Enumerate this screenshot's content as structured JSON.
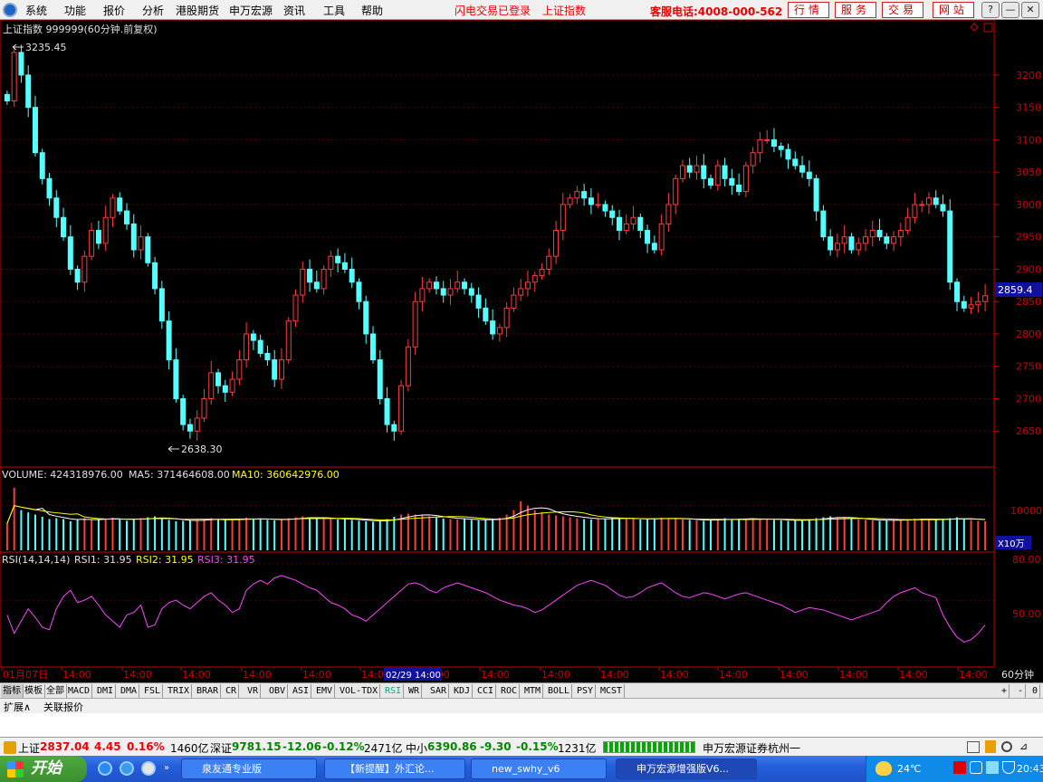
{
  "menubar": {
    "items": [
      "系统",
      "功能",
      "报价",
      "分析",
      "港股期货",
      "申万宏源",
      "资讯",
      "工具",
      "帮助"
    ],
    "status_login": "闪电交易已登录",
    "status_index": "上证指数",
    "hotline": "客服电话:4008-000-562",
    "nav_buttons": [
      "行情",
      "服务",
      "交易",
      "网站"
    ],
    "window_controls": [
      "?",
      "—",
      "❐",
      "✕"
    ]
  },
  "chart_header": {
    "title": "上证指数 999999(60分钟.前复权)",
    "max_label": "3235.45",
    "min_label": "2638.30",
    "last_price": "2859.4"
  },
  "volume_header": {
    "label": "VOLUME: 424318976.00",
    "ma5": "MA5: 371464608.00",
    "ma10": "MA10: 360642976.00",
    "unit": "X10万",
    "tick": "10000"
  },
  "rsi_header": {
    "label": "RSI(14,14,14)",
    "rsi1": "RSI1: 31.95",
    "rsi2": "RSI2: 31.95",
    "rsi3": "RSI3: 31.95"
  },
  "time_axis": {
    "labels": [
      "01月07日",
      "14:00",
      "14:00",
      "14:00",
      "14:00",
      "14:00",
      "14:00",
      "14:00",
      "14:00",
      "14:00",
      "14:00",
      "14:00",
      "14:00",
      "14:00",
      "14:00",
      "14:00",
      "14:00"
    ],
    "cursor_label": "02/29 14:00",
    "period": "60分钟"
  },
  "indicator_tabs": [
    "指标",
    "模板",
    "全部",
    "MACD",
    "DMI",
    "DMA",
    "FSL",
    "TRIX",
    "BRAR",
    "CR",
    "VR",
    "OBV",
    "ASI",
    "EMV",
    "VOL-TDX",
    "RSI",
    "WR",
    "SAR",
    "KDJ",
    "CCI",
    "ROC",
    "MTM",
    "BOLL",
    "PSY",
    "MCST"
  ],
  "active_tab": "RSI",
  "ext_bar": [
    "扩展∧",
    "关联报价"
  ],
  "index_bar": {
    "sh_name": "上证",
    "sh_value": "2837.04",
    "sh_change": "4.45",
    "sh_pct": "0.16%",
    "sh_amount": "1460亿",
    "sz_name": "深证",
    "sz_value": "9781.15",
    "sz_change": "-12.06",
    "sz_pct": "-0.12%",
    "sz_amount": "2471亿",
    "zx_name": "中小",
    "zx_value": "6390.86",
    "zx_change": "-9.30",
    "zx_pct": "-0.15%",
    "zx_amount": "1231亿",
    "broker": "申万宏源证券杭州一"
  },
  "taskbar": {
    "start": "开始",
    "buttons": [
      "泉友通专业版",
      "【新提醒】外汇论...",
      "new_swhy_v6",
      "申万宏源增强版V6..."
    ],
    "temperature": "24℃",
    "time": "20:43"
  },
  "colors": {
    "up": "#ff3c3c",
    "down": "#54ffff",
    "ma5": "#ffffff",
    "ma10": "#ffff00",
    "rsi": "#ff44ff",
    "axis": "#c80000"
  },
  "chart_data": [
    {
      "type": "candlestick",
      "title": "上证指数 999999(60分钟.前复权)",
      "ylim": [
        2600,
        3260
      ],
      "yticks": [
        2650,
        2700,
        2750,
        2800,
        2850,
        2900,
        2950,
        3000,
        3050,
        3100,
        3150,
        3200
      ],
      "x_tick_labels": [
        "01月07日",
        "14:00",
        "14:00",
        "14:00",
        "14:00",
        "14:00",
        "14:00",
        "14:00",
        "14:00",
        "14:00",
        "14:00",
        "14:00",
        "14:00",
        "14:00",
        "14:00",
        "14:00",
        "14:00"
      ],
      "close": [
        3160,
        3235,
        3200,
        3150,
        3080,
        3040,
        3010,
        2980,
        2950,
        2900,
        2880,
        2920,
        2960,
        2940,
        2980,
        3010,
        2990,
        2970,
        2930,
        2950,
        2910,
        2870,
        2820,
        2760,
        2700,
        2660,
        2650,
        2670,
        2700,
        2740,
        2720,
        2710,
        2730,
        2760,
        2800,
        2790,
        2770,
        2760,
        2730,
        2760,
        2820,
        2860,
        2900,
        2880,
        2870,
        2900,
        2920,
        2910,
        2900,
        2880,
        2850,
        2800,
        2760,
        2700,
        2660,
        2650,
        2720,
        2780,
        2850,
        2870,
        2880,
        2870,
        2860,
        2870,
        2880,
        2870,
        2860,
        2840,
        2820,
        2800,
        2810,
        2840,
        2860,
        2870,
        2880,
        2890,
        2900,
        2920,
        2960,
        3000,
        3010,
        3020,
        3010,
        3000,
        3000,
        2990,
        2980,
        2960,
        2970,
        2980,
        2960,
        2940,
        2930,
        2970,
        3000,
        3040,
        3060,
        3050,
        3060,
        3040,
        3030,
        3060,
        3040,
        3030,
        3020,
        3060,
        3080,
        3100,
        3100,
        3090,
        3085,
        3070,
        3060,
        3050,
        3040,
        2990,
        2950,
        2930,
        2940,
        2950,
        2930,
        2940,
        2950,
        2960,
        2950,
        2940,
        2950,
        2960,
        2980,
        3000,
        3000,
        3010,
        3000,
        2990,
        2880,
        2850,
        2840,
        2845,
        2850,
        2859
      ],
      "volume": [
        6000,
        14000,
        9000,
        8500,
        8000,
        7500,
        7000,
        7200,
        7000,
        6500,
        6800,
        7200,
        7000,
        6800,
        7100,
        7300,
        7000,
        6600,
        7000,
        7200,
        7400,
        7600,
        7000,
        6800,
        6500,
        6600,
        6700,
        6800,
        7000,
        7200,
        7000,
        6800,
        6900,
        7100,
        7300,
        7000,
        6900,
        6800,
        6700,
        7000,
        7200,
        7400,
        7600,
        7300,
        7000,
        7200,
        7100,
        6900,
        7000,
        6800,
        6600,
        6500,
        6400,
        6600,
        7000,
        7500,
        8000,
        8200,
        8000,
        7800,
        7600,
        7300,
        7100,
        7000,
        6900,
        7000,
        6800,
        6700,
        6800,
        7000,
        7300,
        8000,
        9000,
        11000,
        10000,
        9000,
        8500,
        8000,
        7800,
        7600,
        7400,
        7200,
        7000,
        6900,
        7000,
        7100,
        7300,
        7200,
        7100,
        7000,
        6900,
        7000,
        7200,
        7300,
        7200,
        7000,
        6900,
        6800,
        6700,
        6600,
        6800,
        7000,
        7200,
        7000,
        6900,
        7000,
        7200,
        7000,
        6900,
        6800,
        6700,
        6600,
        6700,
        6800,
        7000,
        7200,
        7400,
        7600,
        7400,
        7200,
        7000,
        6900,
        6800,
        6700,
        6600,
        6700,
        6800,
        6900,
        7000,
        7100,
        7000,
        6900,
        6800,
        7000,
        7200,
        7400,
        7000,
        6800,
        6600,
        6500
      ],
      "rsi": [
        40,
        25,
        35,
        45,
        38,
        30,
        28,
        45,
        55,
        60,
        50,
        52,
        55,
        48,
        40,
        35,
        30,
        40,
        42,
        48,
        30,
        32,
        45,
        50,
        52,
        48,
        45,
        50,
        55,
        58,
        52,
        48,
        42,
        45,
        60,
        65,
        68,
        65,
        70,
        72,
        70,
        68,
        65,
        62,
        60,
        55,
        50,
        48,
        45,
        40,
        38,
        35,
        40,
        45,
        50,
        55,
        60,
        65,
        66,
        64,
        60,
        58,
        62,
        64,
        66,
        64,
        62,
        60,
        58,
        55,
        52,
        50,
        48,
        47,
        45,
        42,
        44,
        48,
        52,
        56,
        60,
        64,
        66,
        68,
        66,
        64,
        60,
        56,
        54,
        55,
        58,
        62,
        64,
        66,
        62,
        58,
        55,
        54,
        56,
        58,
        57,
        55,
        53,
        55,
        57,
        58,
        56,
        54,
        52,
        50,
        48,
        45,
        42,
        44,
        46,
        45,
        44,
        42,
        40,
        38,
        36,
        38,
        40,
        42,
        44,
        50,
        55,
        58,
        60,
        62,
        58,
        56,
        54,
        40,
        30,
        22,
        18,
        20,
        25,
        31.95
      ]
    }
  ]
}
